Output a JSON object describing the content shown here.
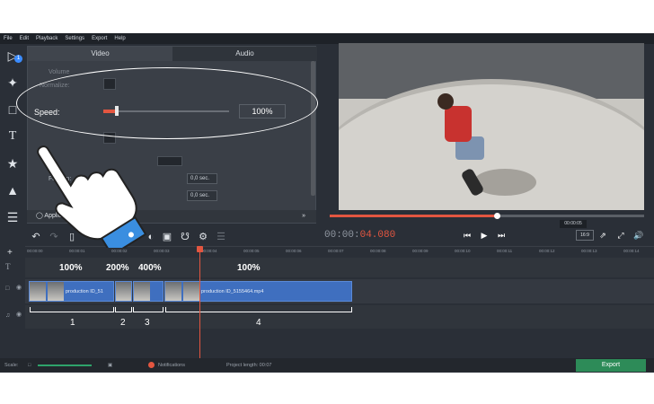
{
  "menu": {
    "items": [
      "File",
      "Edit",
      "Playback",
      "Settings",
      "Export",
      "Help"
    ]
  },
  "sidebar": {
    "badge": "1",
    "icons": [
      "import-icon",
      "magic-wand-icon",
      "crop-icon",
      "title-icon",
      "sticker-icon",
      "transition-icon",
      "menu-icon"
    ]
  },
  "panel": {
    "tabs": [
      "Video",
      "Audio"
    ],
    "props": {
      "volume": "Volume",
      "normalize": "Normalize:",
      "speed": "Speed:",
      "fade_in": "Fade in:"
    },
    "fade_in_value": "0,0 sec.",
    "fade_out_value": "0,0 sec.",
    "speed_value": "100%",
    "speed_fraction": 0.09,
    "applied_effects": "Applied Effects"
  },
  "player": {
    "timecode_gray": "00:00:",
    "timecode_red": "04.080",
    "progress_fraction": 0.53,
    "tooltip": "00:00:05",
    "aspect": "16:9"
  },
  "ruler": {
    "ticks": [
      "00:00:00",
      "00:00:01",
      "00:00:02",
      "00:00:03",
      "00:00:04",
      "00:00:05",
      "00:00:06",
      "00:00:07",
      "00:00:08",
      "00:00:09",
      "00:00:10",
      "00:00:11",
      "00:00:12",
      "00:00:13",
      "00:00:14"
    ]
  },
  "clips": [
    {
      "label": "production ID_51",
      "speed": "100%",
      "number": "1"
    },
    {
      "label": "",
      "speed": "200%",
      "number": "2"
    },
    {
      "label": "",
      "speed": "400%",
      "number": "3"
    },
    {
      "label": "production ID_5155464.mp4",
      "speed": "100%",
      "number": "4"
    }
  ],
  "status": {
    "scale": "Scale:",
    "notifications": "Notifications",
    "project_length": "Project length: 00:07",
    "export": "Export"
  }
}
